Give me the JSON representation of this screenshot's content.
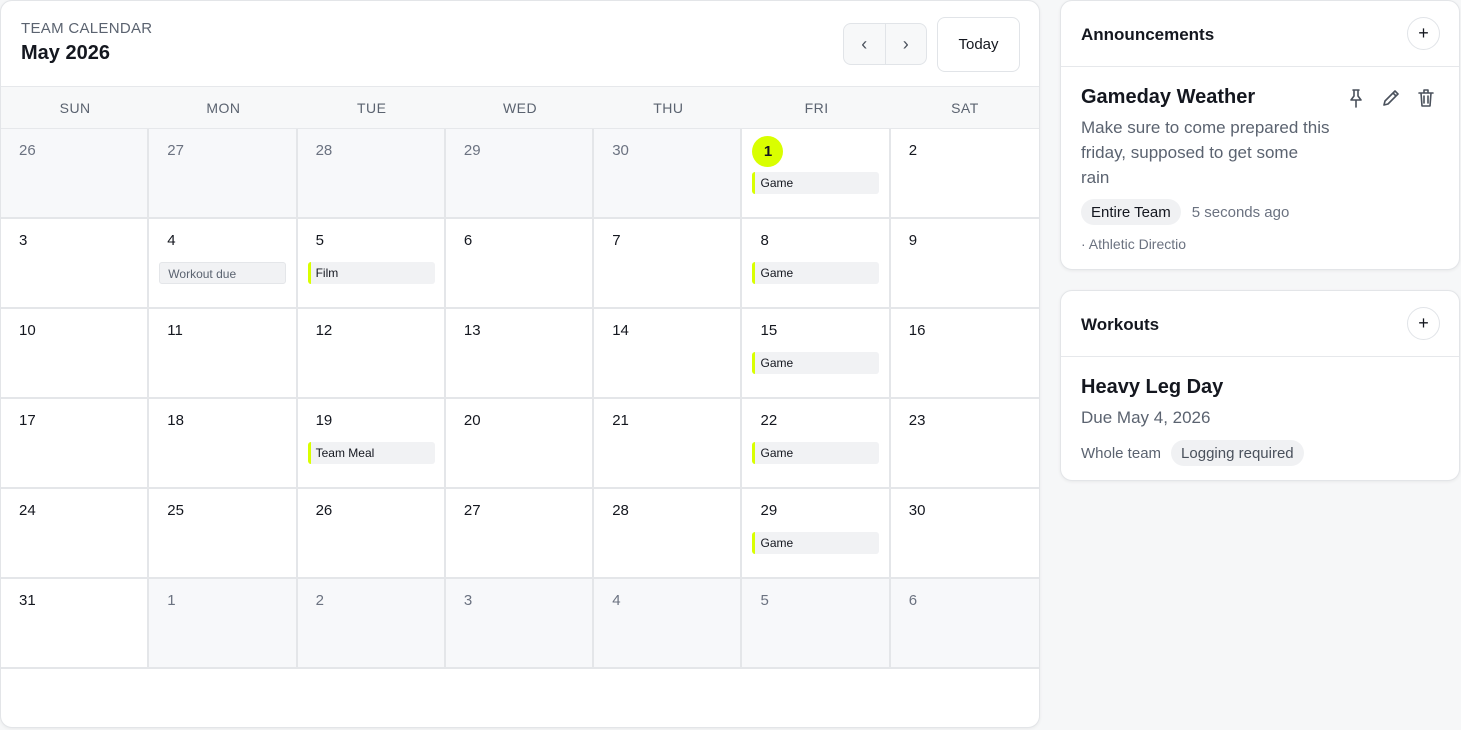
{
  "calendar": {
    "kicker": "TEAM CALENDAR",
    "month_title": "May 2026",
    "prev_label": "‹",
    "next_label": "›",
    "today_label": "Today",
    "weekdays": [
      "SUN",
      "MON",
      "TUE",
      "WED",
      "THU",
      "FRI",
      "SAT"
    ],
    "accent_color": "#d9ff00",
    "days": [
      {
        "num": "26",
        "muted": true
      },
      {
        "num": "27",
        "muted": true
      },
      {
        "num": "28",
        "muted": true
      },
      {
        "num": "29",
        "muted": true
      },
      {
        "num": "30",
        "muted": true
      },
      {
        "num": "1",
        "today": true,
        "event": "Game"
      },
      {
        "num": "2"
      },
      {
        "num": "3"
      },
      {
        "num": "4",
        "event": "Workout due",
        "event_style": "plain"
      },
      {
        "num": "5",
        "event": "Film"
      },
      {
        "num": "6"
      },
      {
        "num": "7"
      },
      {
        "num": "8",
        "event": "Game"
      },
      {
        "num": "9"
      },
      {
        "num": "10"
      },
      {
        "num": "11"
      },
      {
        "num": "12"
      },
      {
        "num": "13"
      },
      {
        "num": "14"
      },
      {
        "num": "15",
        "event": "Game"
      },
      {
        "num": "16"
      },
      {
        "num": "17"
      },
      {
        "num": "18"
      },
      {
        "num": "19",
        "event": "Team Meal"
      },
      {
        "num": "20"
      },
      {
        "num": "21"
      },
      {
        "num": "22",
        "event": "Game"
      },
      {
        "num": "23"
      },
      {
        "num": "24"
      },
      {
        "num": "25"
      },
      {
        "num": "26"
      },
      {
        "num": "27"
      },
      {
        "num": "28"
      },
      {
        "num": "29",
        "event": "Game"
      },
      {
        "num": "30"
      },
      {
        "num": "31"
      },
      {
        "num": "1",
        "muted": true
      },
      {
        "num": "2",
        "muted": true
      },
      {
        "num": "3",
        "muted": true
      },
      {
        "num": "4",
        "muted": true
      },
      {
        "num": "5",
        "muted": true
      },
      {
        "num": "6",
        "muted": true
      }
    ]
  },
  "announcements": {
    "title": "Announcements",
    "add_label": "+",
    "item": {
      "title": "Gameday Weather",
      "body": "Make sure to come prepared this friday, supposed to get some rain",
      "audience": "Entire Team",
      "time": "5 seconds ago",
      "author": "· Athletic Directio",
      "icons": [
        "pin-icon",
        "pencil-icon",
        "trash-icon"
      ]
    }
  },
  "workouts": {
    "title": "Workouts",
    "add_label": "+",
    "item": {
      "title": "Heavy Leg Day",
      "due": "Due May 4, 2026",
      "assigned": "Whole team",
      "badge": "Logging required"
    }
  }
}
